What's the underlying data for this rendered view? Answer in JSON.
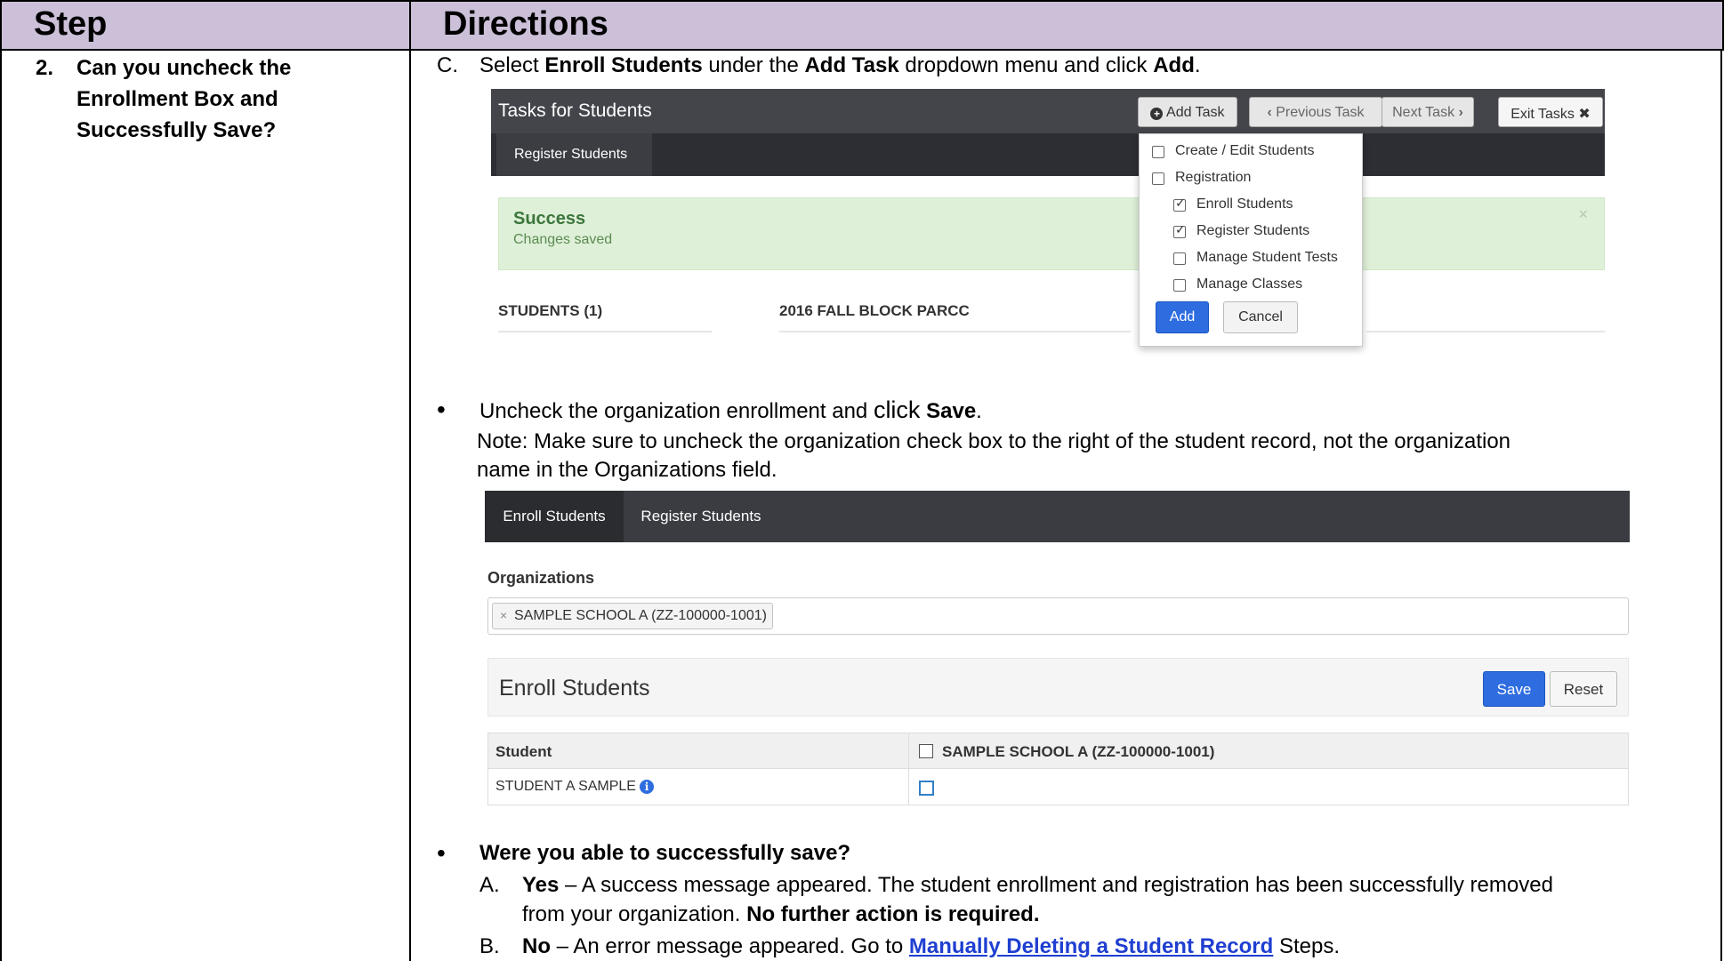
{
  "header": {
    "step": "Step",
    "directions": "Directions"
  },
  "step": {
    "number": "2.",
    "question_lines": [
      "Can you uncheck the",
      "Enrollment Box and",
      "Successfully Save?"
    ]
  },
  "instruction_c": {
    "marker": "C.",
    "t1": "Select ",
    "b1": "Enroll Students",
    "t2": " under the ",
    "b2": "Add Task",
    "t3": " dropdown menu and click ",
    "b3": "Add",
    "t4": "."
  },
  "screenshot1": {
    "title": "Tasks for Students",
    "add_task": "Add Task",
    "previous_task": "Previous Task",
    "next_task": "Next Task",
    "exit_tasks": "Exit Tasks",
    "tab": "Register Students",
    "success_title": "Success",
    "success_message": "Changes saved",
    "close": "×",
    "students_col": "STUDENTS (1)",
    "test_col": "2016 FALL BLOCK PARCC",
    "dropdown": {
      "items": [
        {
          "label": "Create / Edit Students",
          "checked": false,
          "indent": false
        },
        {
          "label": "Registration",
          "checked": false,
          "indent": false
        },
        {
          "label": "Enroll Students",
          "checked": true,
          "indent": true
        },
        {
          "label": "Register Students",
          "checked": true,
          "indent": true
        },
        {
          "label": "Manage Student Tests",
          "checked": false,
          "indent": true
        },
        {
          "label": "Manage Classes",
          "checked": false,
          "indent": true
        }
      ],
      "add": "Add",
      "cancel": "Cancel"
    }
  },
  "bullet1": {
    "t1": "Uncheck the organization enrollment and ",
    "t2": "click",
    "t3": " ",
    "b1": "Save",
    "t4": "."
  },
  "note": {
    "line1": "Note: Make sure to uncheck the organization check box to the right of the student record, not the organization",
    "line2": "name in the Organizations field."
  },
  "screenshot2": {
    "tab_enroll": "Enroll Students",
    "tab_register": "Register Students",
    "organizations_label": "Organizations",
    "org_chip": "SAMPLE SCHOOL A (ZZ-100000-1001)",
    "chip_remove": "×",
    "panel_title": "Enroll Students",
    "save": "Save",
    "reset": "Reset",
    "col_student": "Student",
    "col_org": "SAMPLE SCHOOL A (ZZ-100000-1001)",
    "student_name": "STUDENT A SAMPLE",
    "info": "i"
  },
  "bullet2": {
    "question": "Were you able to successfully save?"
  },
  "option_a": {
    "marker": "A.",
    "b1": "Yes",
    "t1": " – A success message appeared. The student enrollment and registration has been successfully removed",
    "line2_t": "from your organization. ",
    "line2_b": "No further action is required."
  },
  "option_b": {
    "marker": "B.",
    "b1": "No",
    "t1": " – An error message appeared. Go to ",
    "link": "Manually Deleting a Student Record",
    "t2": " Steps."
  }
}
